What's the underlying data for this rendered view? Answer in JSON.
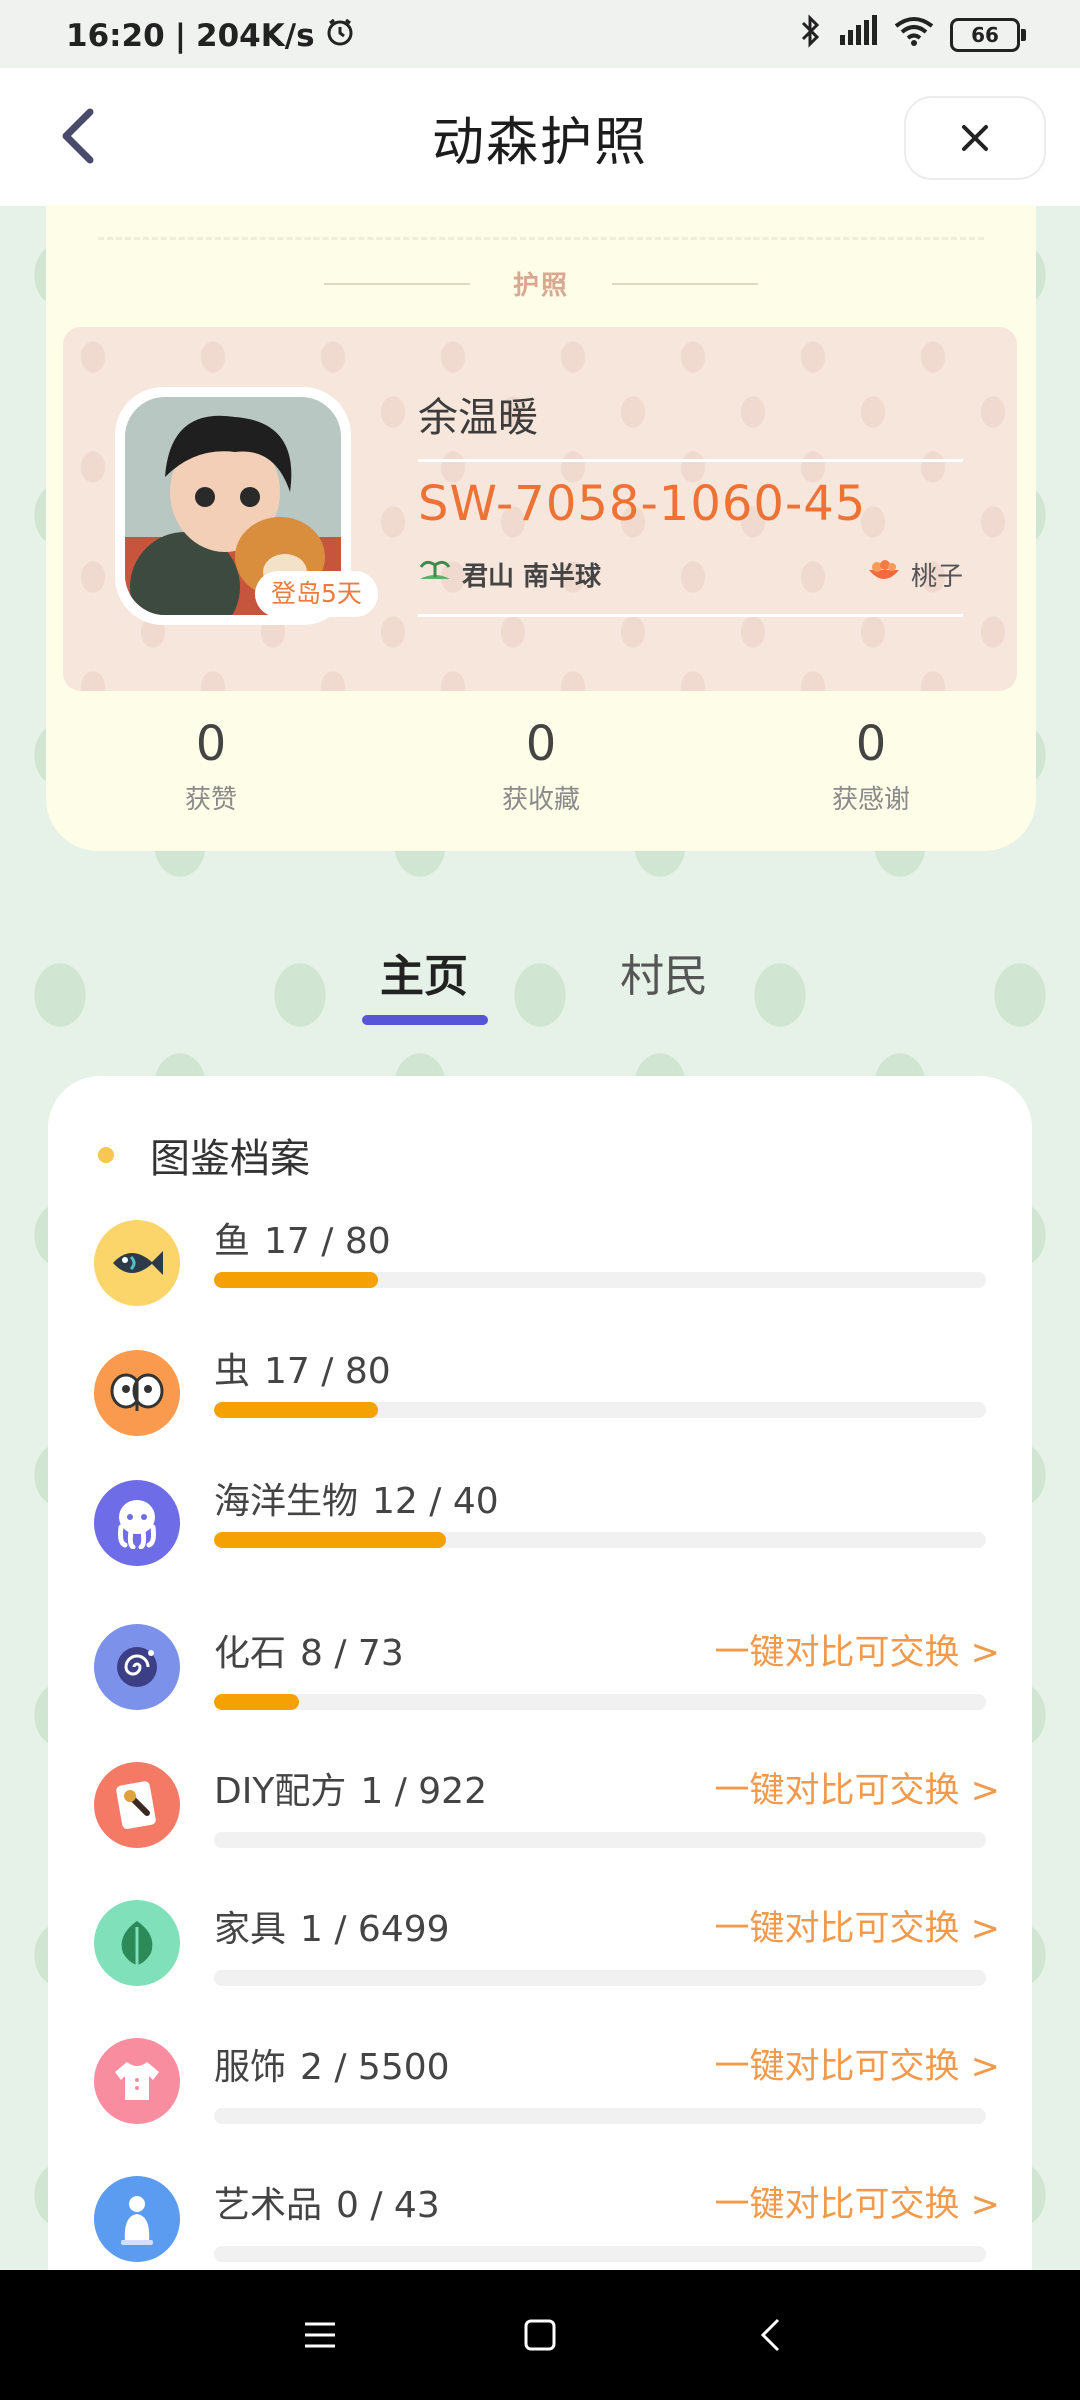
{
  "status_bar": {
    "time": "16:20",
    "network_speed": "204K/s",
    "battery": "66",
    "icons": [
      "alarm-icon",
      "bluetooth-icon",
      "signal-icon",
      "wifi-icon",
      "battery-icon"
    ]
  },
  "header": {
    "title": "动森护照",
    "back_icon": "chevron-left-icon",
    "close_icon": "close-icon"
  },
  "passport": {
    "label": "护照",
    "badge": "登岛5天",
    "nickname": "余温暖",
    "player_id": "SW-7058-1060-45",
    "island": "君山 南半球",
    "fruit": "桃子"
  },
  "stats": [
    {
      "value": "0",
      "label": "获赞"
    },
    {
      "value": "0",
      "label": "获收藏"
    },
    {
      "value": "0",
      "label": "获感谢"
    }
  ],
  "tabs": [
    {
      "label": "主页",
      "active": true
    },
    {
      "label": "村民",
      "active": false
    }
  ],
  "encyclopedia": {
    "title": "图鉴档案",
    "compare_label": "一键对比可交换 >",
    "items": [
      {
        "name": "鱼",
        "count": "17 / 80",
        "progress": 0.2125,
        "icon": "fish-icon",
        "color": "#fbd46a",
        "show_compare": false
      },
      {
        "name": "虫",
        "count": "17 / 80",
        "progress": 0.2125,
        "icon": "bug-icon",
        "color": "#f99a4e",
        "show_compare": false
      },
      {
        "name": "海洋生物",
        "count": "12 / 40",
        "progress": 0.3,
        "icon": "octopus-icon",
        "color": "#6f6ce8",
        "show_compare": false
      },
      {
        "name": "化石",
        "count": "8 / 73",
        "progress": 0.1096,
        "icon": "fossil-icon",
        "color": "#7c92ea",
        "show_compare": true
      },
      {
        "name": "DIY配方",
        "count": "1 / 922",
        "progress": 0.0011,
        "icon": "diy-recipe-icon",
        "color": "#f57a66",
        "show_compare": true
      },
      {
        "name": "家具",
        "count": "1 / 6499",
        "progress": 0.0002,
        "icon": "leaf-icon",
        "color": "#7fe0b9",
        "show_compare": true
      },
      {
        "name": "服饰",
        "count": "2 / 5500",
        "progress": 0.0004,
        "icon": "shirt-icon",
        "color": "#f98da0",
        "show_compare": true
      },
      {
        "name": "艺术品",
        "count": "0 / 43",
        "progress": 0,
        "icon": "art-statue-icon",
        "color": "#5b9bf0",
        "show_compare": true
      }
    ]
  },
  "nav_bar": {
    "icons": [
      "menu-icon",
      "home-icon",
      "back-icon"
    ]
  }
}
